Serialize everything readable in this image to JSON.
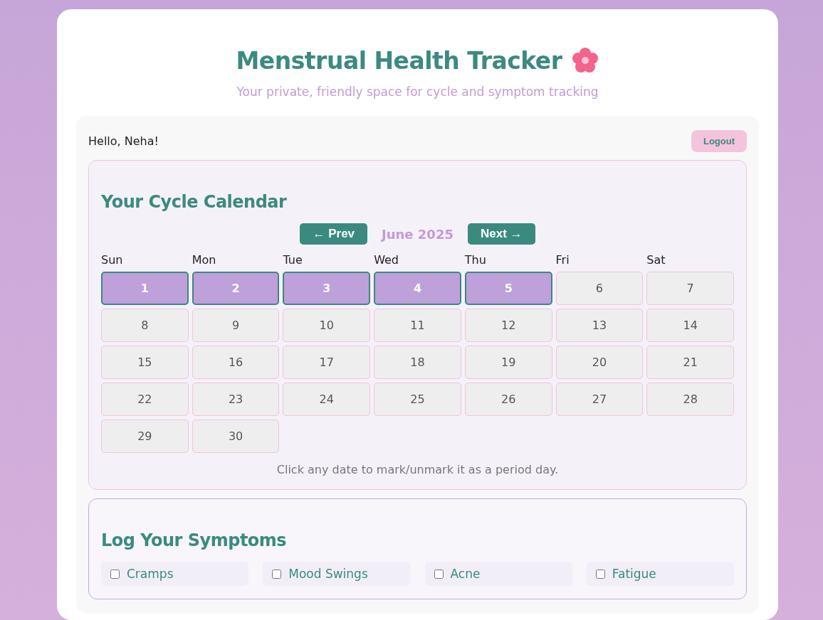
{
  "header": {
    "title": "Menstrual Health Tracker",
    "subtitle": "Your private, friendly space for cycle and symptom tracking"
  },
  "user": {
    "greeting": "Hello, Neha!",
    "logout": "Logout"
  },
  "calendar": {
    "title": "Your Cycle Calendar",
    "prev": "← Prev",
    "month": "June 2025",
    "next": "Next →",
    "weekdays": [
      "Sun",
      "Mon",
      "Tue",
      "Wed",
      "Thu",
      "Fri",
      "Sat"
    ],
    "days": [
      {
        "label": "1",
        "marked": true
      },
      {
        "label": "2",
        "marked": true
      },
      {
        "label": "3",
        "marked": true
      },
      {
        "label": "4",
        "marked": true
      },
      {
        "label": "5",
        "marked": true
      },
      {
        "label": "6",
        "marked": false
      },
      {
        "label": "7",
        "marked": false
      },
      {
        "label": "8",
        "marked": false
      },
      {
        "label": "9",
        "marked": false
      },
      {
        "label": "10",
        "marked": false
      },
      {
        "label": "11",
        "marked": false
      },
      {
        "label": "12",
        "marked": false
      },
      {
        "label": "13",
        "marked": false
      },
      {
        "label": "14",
        "marked": false
      },
      {
        "label": "15",
        "marked": false
      },
      {
        "label": "16",
        "marked": false
      },
      {
        "label": "17",
        "marked": false
      },
      {
        "label": "18",
        "marked": false
      },
      {
        "label": "19",
        "marked": false
      },
      {
        "label": "20",
        "marked": false
      },
      {
        "label": "21",
        "marked": false
      },
      {
        "label": "22",
        "marked": false
      },
      {
        "label": "23",
        "marked": false
      },
      {
        "label": "24",
        "marked": false
      },
      {
        "label": "25",
        "marked": false
      },
      {
        "label": "26",
        "marked": false
      },
      {
        "label": "27",
        "marked": false
      },
      {
        "label": "28",
        "marked": false
      },
      {
        "label": "29",
        "marked": false
      },
      {
        "label": "30",
        "marked": false
      }
    ],
    "hint": "Click any date to mark/unmark it as a period day."
  },
  "symptoms": {
    "title": "Log Your Symptoms",
    "items": [
      {
        "label": "Cramps",
        "checked": false
      },
      {
        "label": "Mood Swings",
        "checked": false
      },
      {
        "label": "Acne",
        "checked": false
      },
      {
        "label": "Fatigue",
        "checked": false
      }
    ]
  }
}
